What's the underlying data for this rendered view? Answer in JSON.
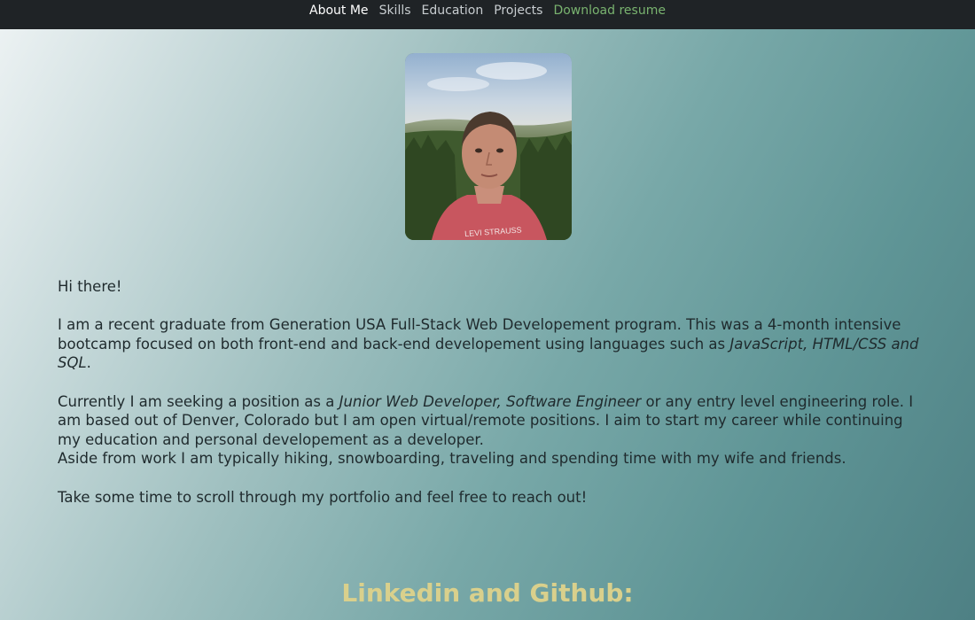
{
  "nav": {
    "items": [
      {
        "label": "About Me",
        "active": true
      },
      {
        "label": "Skills"
      },
      {
        "label": "Education"
      },
      {
        "label": "Projects"
      },
      {
        "label": "Download resume"
      }
    ]
  },
  "intro": {
    "greeting": "Hi there!",
    "p1_start": "I am a recent graduate from Generation USA Full-Stack Web Developement program. This was a 4-month intensive bootcamp focused on both front-end and back-end developement using languages such as ",
    "p1_em": "JavaScript, HTML/CSS and SQL",
    "p1_end": ".",
    "p2_start": "Currently I am seeking a position as a ",
    "p2_em": "Junior Web Developer, Software Engineer",
    "p2_end": " or any entry level engineering role. I am based out of Denver, Colorado but I am open virtual/remote positions. I aim to start my career while continuing my education and personal developement as a developer.",
    "p3": "Aside from work I am typically hiking, snowboarding, traveling and spending time with my wife and friends.",
    "p4": "Take some time to scroll through my portfolio and feel free to reach out!"
  },
  "links_section": {
    "title": "Linkedin and Github:"
  },
  "colors": {
    "nav_bg": "#1f2326",
    "nav_active": "#ffffff",
    "nav_link": "#c8cdd0",
    "nav_download": "#79b36f",
    "section_title": "#d9d08c"
  }
}
